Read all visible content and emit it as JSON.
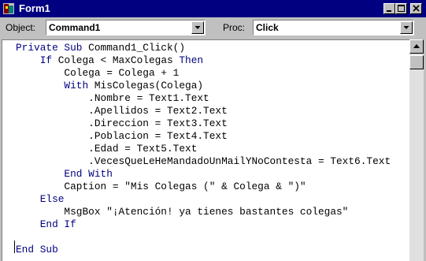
{
  "window": {
    "title": "Form1"
  },
  "toolbar": {
    "object_label": "Object:",
    "object_value": "Command1",
    "proc_label": "Proc:",
    "proc_value": "Click"
  },
  "code": {
    "lines": [
      [
        {
          "t": "Private Sub ",
          "k": true
        },
        {
          "t": "Command1_Click()",
          "k": false
        }
      ],
      [
        {
          "t": "    If ",
          "k": true
        },
        {
          "t": "Colega < MaxColegas ",
          "k": false
        },
        {
          "t": "Then",
          "k": true
        }
      ],
      [
        {
          "t": "        Colega = Colega + 1",
          "k": false
        }
      ],
      [
        {
          "t": "        With ",
          "k": true
        },
        {
          "t": "MisColegas(Colega)",
          "k": false
        }
      ],
      [
        {
          "t": "            .Nombre = Text1.Text",
          "k": false
        }
      ],
      [
        {
          "t": "            .Apellidos = Text2.Text",
          "k": false
        }
      ],
      [
        {
          "t": "            .Direccion = Text3.Text",
          "k": false
        }
      ],
      [
        {
          "t": "            .Poblacion = Text4.Text",
          "k": false
        }
      ],
      [
        {
          "t": "            .Edad = Text5.Text",
          "k": false
        }
      ],
      [
        {
          "t": "            .VecesQueLeHeMandadoUnMailYNoContesta = Text6.Text",
          "k": false
        }
      ],
      [
        {
          "t": "        End With",
          "k": true
        }
      ],
      [
        {
          "t": "        Caption = \"Mis Colegas (\" & Colega & \")\"",
          "k": false
        }
      ],
      [
        {
          "t": "    Else",
          "k": true
        }
      ],
      [
        {
          "t": "        MsgBox \"¡Atención! ya tienes bastantes colegas\"",
          "k": false
        }
      ],
      [
        {
          "t": "    End If",
          "k": true
        }
      ],
      [
        {
          "t": "",
          "k": false
        }
      ],
      [
        {
          "t": "End Sub",
          "k": true
        }
      ]
    ]
  },
  "colors": {
    "titlebar": "#000080",
    "keyword": "#00007f",
    "face": "#c0c0c0"
  },
  "icons": [
    "app-icon",
    "minimize-icon",
    "maximize-icon",
    "close-icon",
    "dropdown-arrow-icon",
    "scroll-up-arrow-icon"
  ]
}
